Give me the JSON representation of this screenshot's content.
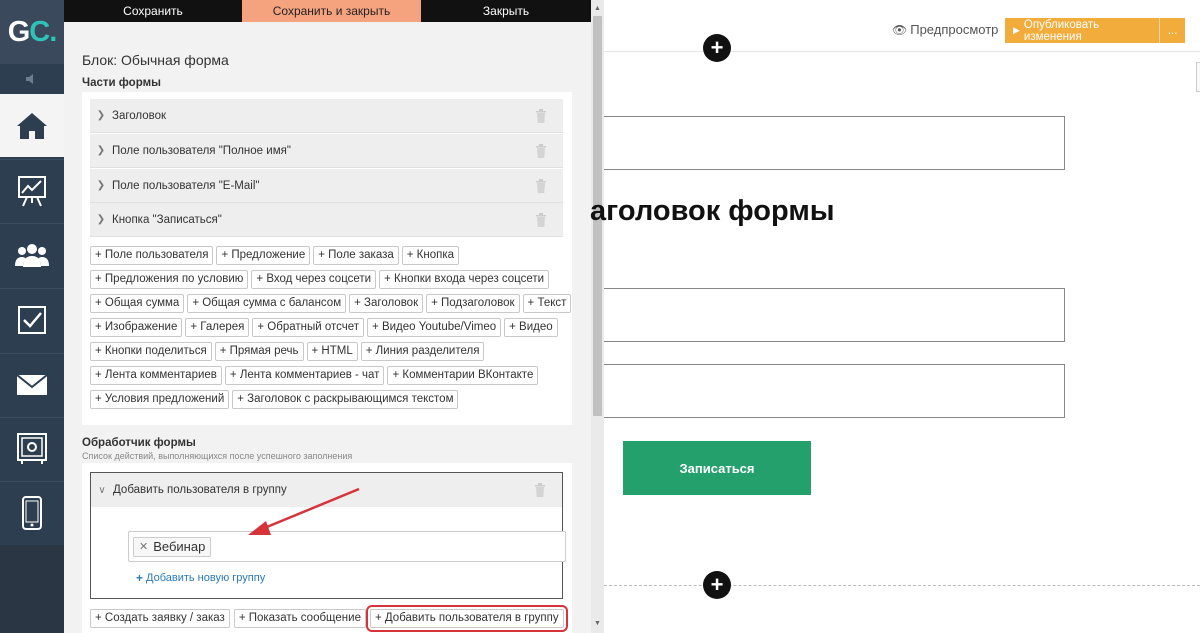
{
  "app": {
    "logo": {
      "text": "G",
      "accent": "C."
    },
    "accent_color": "#2fc3b8"
  },
  "nav": {
    "items": [
      {
        "name": "home",
        "icon": "home-icon",
        "active": true
      },
      {
        "name": "statistics",
        "icon": "chart-board-icon"
      },
      {
        "name": "users",
        "icon": "users-icon"
      },
      {
        "name": "tasks",
        "icon": "checkbox-icon"
      },
      {
        "name": "messages",
        "icon": "envelope-icon"
      },
      {
        "name": "safe",
        "icon": "safe-icon"
      },
      {
        "name": "mobile",
        "icon": "phone-icon"
      }
    ]
  },
  "toolbar": {
    "save": "Сохранить",
    "save_close": "Сохранить и закрыть",
    "close": "Закрыть"
  },
  "block": {
    "title": "Блок: Обычная форма",
    "parts_title": "Части формы",
    "parts": [
      "Заголовок",
      "Поле пользователя \"Полное имя\"",
      "Поле пользователя \"E-Mail\"",
      "Кнопка \"Записаться\""
    ],
    "add_parts": [
      [
        "+ Поле пользователя",
        "+ Предложение",
        "+ Поле заказа",
        "+ Кнопка"
      ],
      [
        "+ Предложения по условию",
        "+ Вход через соцсети",
        "+ Кнопки входа через соцсети"
      ],
      [
        "+ Общая сумма",
        "+ Общая сумма с балансом",
        "+ Заголовок",
        "+ Подзаголовок",
        "+ Текст"
      ],
      [
        "+ Изображение",
        "+ Галерея",
        "+ Обратный отсчет",
        "+ Видео Youtube/Vimeo",
        "+ Видео"
      ],
      [
        "+ Кнопки поделиться",
        "+ Прямая речь",
        "+ HTML",
        "+ Линия разделителя"
      ],
      [
        "+ Лента комментариев",
        "+ Лента комментариев - чат",
        "+ Комментарии ВКонтакте"
      ],
      [
        "+ Условия предложений",
        "+ Заголовок с раскрывающимся текстом"
      ]
    ]
  },
  "handler": {
    "title": "Обработчик формы",
    "subtitle": "Список действий, выполняющихся после успешного заполнения",
    "action_title": "Добавить пользователя в группу",
    "group_chip": "Вебинар",
    "add_group": "Добавить новую группу",
    "actions": [
      "+ Создать заявку / заказ",
      "+ Показать сообщение",
      "+ Добавить пользователя в группу"
    ],
    "highlight_color": "#d6333a"
  },
  "canvas": {
    "preview": "Предпросмотр",
    "publish": "Опубликовать изменения",
    "publish_more": "...",
    "publish_color": "#f2ac3c",
    "form_heading": "аголовок формы",
    "submit": "Записаться",
    "submit_color": "#23a06c"
  }
}
